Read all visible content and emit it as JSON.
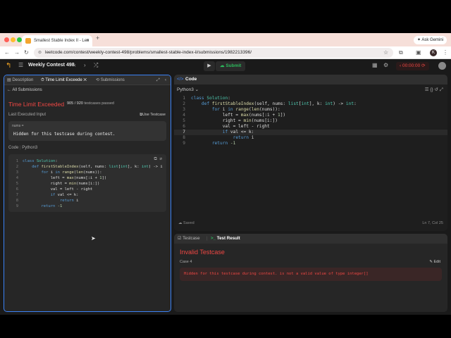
{
  "browser": {
    "tab_title": "Smallest Stable Index II - Lee",
    "new_tab": "+",
    "ask_gemini": "Ask Gemini",
    "url": "leetcode.com/contest/weekly-contest-498/problems/smallest-stable-index-ii/submissions/1982213396/",
    "profile_initial": "K"
  },
  "header": {
    "contest_title": "Weekly Contest 498",
    "submit_label": "Submit",
    "timer": "00:00:00"
  },
  "left_panel": {
    "tabs": [
      {
        "label": "Description"
      },
      {
        "label": "Time Limit Exceede"
      },
      {
        "label": "Submissions"
      }
    ],
    "all_submissions": "All Submissions",
    "result": "Time Limit Exceeded",
    "passed": "905 / 920",
    "passed_suffix": "testcases passed",
    "last_input_label": "Last Executed Input",
    "use_testcase": "Use Testcase",
    "input_name": "nums =",
    "input_value": "Hidden for this testcase during contest.",
    "code_label": "Code",
    "code_lang": "Python3",
    "code_lines": [
      "class Solution:",
      "    def firstStableIndex(self, nums: list[int], k: int) -> i",
      "        for i in range(len(nums)):",
      "            left = max(nums[:i + 1])",
      "            right = min(nums[i:])",
      "            val = left - right",
      "            if val <= k:",
      "                return i",
      "        return -1"
    ]
  },
  "code_panel": {
    "title": "Code",
    "language": "Python3",
    "lines": [
      "class Solution:",
      "    def firstStableIndex(self, nums: list[int], k: int) -> int:",
      "        for i in range(len(nums)):",
      "            left = max(nums[:i + 1])",
      "            right = min(nums[i:])",
      "            val = left - right",
      "            if val <= k:",
      "                return i",
      "        return -1"
    ],
    "line_numbers": [
      "1",
      "2",
      "3",
      "4",
      "5",
      "6",
      "7",
      "8",
      "9"
    ],
    "status_saved": "Saved",
    "cursor_pos": "Ln 7, Col 25"
  },
  "test_panel": {
    "tabs": [
      {
        "label": "Testcase"
      },
      {
        "label": "Test Result"
      }
    ],
    "heading": "Invalid Testcase",
    "case_label": "Case 4",
    "edit_label": "Edit",
    "error": "Hidden for this testcase during contest. is not a valid value of type integer[]"
  },
  "colors": {
    "error_red": "#ef4743",
    "accent_blue": "#3b82f6",
    "submit_green": "#2cbb5d"
  }
}
